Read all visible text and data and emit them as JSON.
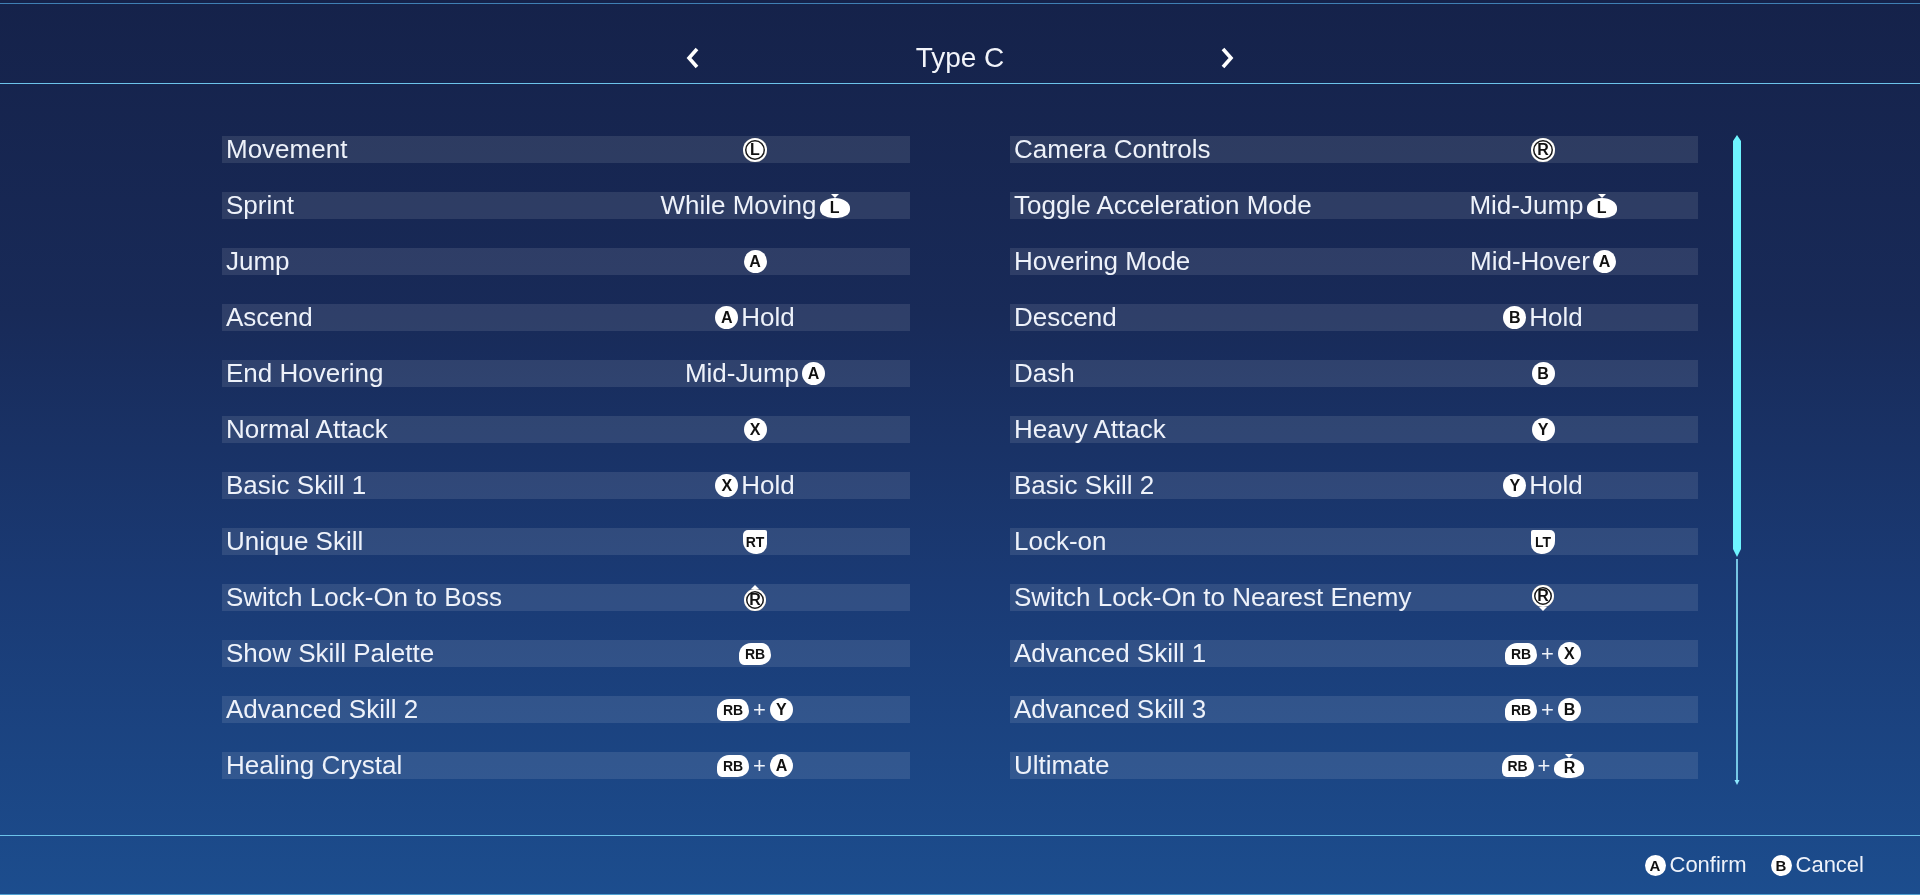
{
  "header": {
    "title": "Type C"
  },
  "columns": [
    {
      "rows": [
        {
          "action": "Movement",
          "binding": [
            {
              "kind": "stick",
              "text": "L"
            }
          ]
        },
        {
          "action": "Sprint",
          "binding": [
            {
              "kind": "text",
              "text": "While Moving"
            },
            {
              "kind": "stick-press",
              "text": "L"
            }
          ]
        },
        {
          "action": "Jump",
          "binding": [
            {
              "kind": "face",
              "text": "A"
            }
          ]
        },
        {
          "action": "Ascend",
          "binding": [
            {
              "kind": "face",
              "text": "A"
            },
            {
              "kind": "text",
              "text": "Hold"
            }
          ]
        },
        {
          "action": "End Hovering",
          "binding": [
            {
              "kind": "text",
              "text": "Mid-Jump"
            },
            {
              "kind": "face",
              "text": "A"
            }
          ]
        },
        {
          "action": "Normal Attack",
          "binding": [
            {
              "kind": "face",
              "text": "X"
            }
          ]
        },
        {
          "action": "Basic Skill 1",
          "binding": [
            {
              "kind": "face",
              "text": "X"
            },
            {
              "kind": "text",
              "text": "Hold"
            }
          ]
        },
        {
          "action": "Unique Skill",
          "binding": [
            {
              "kind": "trigger-right",
              "text": "RT"
            }
          ]
        },
        {
          "action": "Switch Lock-On to Boss",
          "binding": [
            {
              "kind": "stick-up",
              "text": "R"
            }
          ]
        },
        {
          "action": "Show Skill Palette",
          "binding": [
            {
              "kind": "bumper",
              "text": "RB"
            }
          ]
        },
        {
          "action": "Advanced Skill 2",
          "binding": [
            {
              "kind": "bumper",
              "text": "RB"
            },
            {
              "kind": "plus",
              "text": "+"
            },
            {
              "kind": "face",
              "text": "Y"
            }
          ]
        },
        {
          "action": "Healing Crystal",
          "binding": [
            {
              "kind": "bumper",
              "text": "RB"
            },
            {
              "kind": "plus",
              "text": "+"
            },
            {
              "kind": "face",
              "text": "A"
            }
          ]
        }
      ]
    },
    {
      "rows": [
        {
          "action": "Camera Controls",
          "binding": [
            {
              "kind": "stick",
              "text": "R"
            }
          ]
        },
        {
          "action": "Toggle Acceleration Mode",
          "binding": [
            {
              "kind": "text",
              "text": "Mid-Jump"
            },
            {
              "kind": "stick-press",
              "text": "L"
            }
          ]
        },
        {
          "action": "Hovering Mode",
          "binding": [
            {
              "kind": "text",
              "text": "Mid-Hover"
            },
            {
              "kind": "face",
              "text": "A"
            }
          ]
        },
        {
          "action": "Descend",
          "binding": [
            {
              "kind": "face",
              "text": "B"
            },
            {
              "kind": "text",
              "text": "Hold"
            }
          ]
        },
        {
          "action": "Dash",
          "binding": [
            {
              "kind": "face",
              "text": "B"
            }
          ]
        },
        {
          "action": "Heavy Attack",
          "binding": [
            {
              "kind": "face",
              "text": "Y"
            }
          ]
        },
        {
          "action": "Basic Skill 2",
          "binding": [
            {
              "kind": "face",
              "text": "Y"
            },
            {
              "kind": "text",
              "text": "Hold"
            }
          ]
        },
        {
          "action": "Lock-on",
          "binding": [
            {
              "kind": "trigger-left",
              "text": "LT"
            }
          ]
        },
        {
          "action": "Switch Lock-On to Nearest Enemy",
          "binding": [
            {
              "kind": "stick-down",
              "text": "R"
            }
          ]
        },
        {
          "action": "Advanced Skill 1",
          "binding": [
            {
              "kind": "bumper",
              "text": "RB"
            },
            {
              "kind": "plus",
              "text": "+"
            },
            {
              "kind": "face",
              "text": "X"
            }
          ]
        },
        {
          "action": "Advanced Skill 3",
          "binding": [
            {
              "kind": "bumper",
              "text": "RB"
            },
            {
              "kind": "plus",
              "text": "+"
            },
            {
              "kind": "face",
              "text": "B"
            }
          ]
        },
        {
          "action": "Ultimate",
          "binding": [
            {
              "kind": "bumper",
              "text": "RB"
            },
            {
              "kind": "plus",
              "text": "+"
            },
            {
              "kind": "stick-press",
              "text": "R"
            }
          ]
        }
      ]
    }
  ],
  "footer": {
    "actions": [
      {
        "glyph": {
          "kind": "face",
          "text": "A"
        },
        "label": "Confirm"
      },
      {
        "glyph": {
          "kind": "face",
          "text": "B"
        },
        "label": "Cancel"
      }
    ]
  }
}
